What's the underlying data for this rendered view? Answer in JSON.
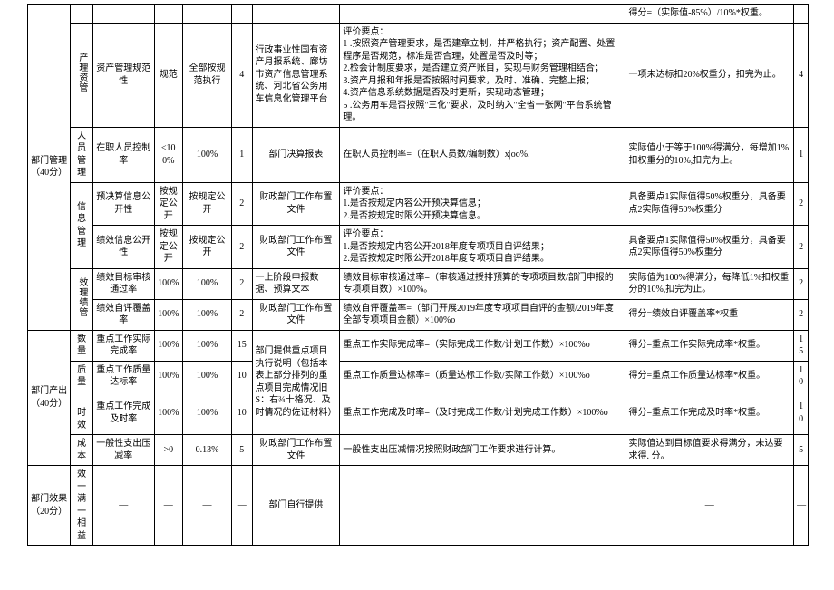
{
  "toprow": {
    "c8": "得分=（实际值-85%）/10%*权重。"
  },
  "sec1": {
    "label": "部门管理（40分）",
    "row1": {
      "g": "产理资管",
      "name": "资产管理规范性",
      "std": "规范",
      "val": "全部按规范执行",
      "w": "4",
      "basis": "行政事业性国有资产月报系统、廊坊市资产信息管理系统、河北省公务用车信息化管理平台",
      "desc": "评价要点：\n1 .按照资产管理要求，是否建章立制，并严格执行；资产配置、处置程序是否规范，标准是否合理，处置是否及时等；\n2.检会计制度要求，是否建立资产账目，实现与财务管理相结合；\n3.资产月报和年报是否按照时间要求，及时、准确、完整上报；\n4.资产信息系统数据是否及时更新，实现动态管理；\n5 .公务用车是否按照\"三化\"要求，及时纳入\"全省一张网\"平台系统管理。",
      "rule": "一项未达标扣20%权重分，扣完为止。",
      "score": "4"
    },
    "row2": {
      "g": "人员管理",
      "name": "在职人员控制率",
      "std": "≤100%",
      "val": "100%",
      "w": "1",
      "basis": "部门决算报表",
      "desc": "在职人员控制率=（在职人员数/编制数）x|oo%.",
      "rule": "实际值小于等于100%得满分，每增加1%扣权重分的10%,扣完为止。",
      "score": "1"
    },
    "row3": {
      "g": "信息管理",
      "name": "预决算信息公开性",
      "std": "按规定公开",
      "val": "按规定公开",
      "w": "2",
      "basis": "财政部门工作布置文件",
      "desc": "评价要点：\n1.是否按规定内容公开预决算信息；\n2.是否按规定时限公开预决算信息。",
      "rule": "具备要点1实际值得50%权重分，具备要点2实际值得50%权重分",
      "score": "2"
    },
    "row4": {
      "name": "绩效信息公开性",
      "std": "按规定公开",
      "val": "按规定公开",
      "w": "2",
      "basis": "财政部门工作布置文件",
      "desc": "评价要点：\n1.是否按规定内容公开2018年度专项项目自评结果；\n2.是否按规定时限公开2018年度专项项目自评结果。",
      "rule": "具备要点1实际值得50%权重分，具备要点2实际值得50%权重分",
      "score": "2"
    },
    "row5": {
      "g": "效理绩管",
      "name": "绩效目标审核通过率",
      "std": "100%",
      "val": "100%",
      "w": "2",
      "basis": "一上阶段申报数据、预算文本",
      "desc": "绩效目标审核通过率=（审核通过授排预算的专项项目数/部门申报的专项项目数）×100%。",
      "rule": "实际值为100%得满分，每降低1%扣权重分的10%,扣完为止。",
      "score": "2"
    },
    "row6": {
      "name": "绩效自评覆盖率",
      "std": "100%",
      "val": "100%",
      "w": "2",
      "basis": "财政部门工作布置文件",
      "desc": "绩效自评覆盖率=（部门开展2019年度专项项目自评的金额/2019年度全部专项项目金额）×100%o",
      "rule": "得分=绩效自评覆盖率*权重",
      "score": "2"
    }
  },
  "sec2": {
    "label": "部门产出（40分）",
    "row7": {
      "g": "数量",
      "name": "重点工作实际完成率",
      "std": "100%",
      "val": "100%",
      "w": "15",
      "basis": "部门提供重点项目执行说明（包括本表上部分排列的重点项目完成情况旧S：右¾十格况、及时情况的佐证材料）",
      "desc": "重点工作实际完成率=（实际完成工作数/计划工作数）×100%o",
      "rule": "得分=重点工作实际完成率*权重。",
      "score": "15"
    },
    "row8": {
      "g": "质量",
      "name": "重点工作质量达标率",
      "std": "100%",
      "val": "100%",
      "w": "10",
      "desc": "重点工作质量达标率=（质量达标工作数/实际工作数）×100%o",
      "rule": "得分=重点工作质量达标率*权重。",
      "score": "10"
    },
    "row9": {
      "g": "—时效",
      "name": "重点工作完成及时率",
      "std": "100%",
      "val": "100%",
      "w": "10",
      "desc": "重点工作完成及时率=（及时完成工作数/计划完成工作数）×100%o",
      "rule": "得分=重点工作完成及时率*权重。",
      "score": "10"
    },
    "row10": {
      "g": "成本",
      "name": "一般性支出压减率",
      "std": ">0",
      "val": "0.13%",
      "w": "5",
      "basis": "财政部门工作布置文件",
      "desc": "一般性支出压减情况按照财政部门工作要求进行计算。",
      "rule": "实际值达到目标值要求得满分，未达要求得. 分。",
      "score": "5"
    }
  },
  "sec3": {
    "label": "部门效果（20分）",
    "row11": {
      "g": "效一满一相益",
      "name": "—",
      "std": "—",
      "val": "—",
      "w": "—",
      "basis": "部门自行提供",
      "desc": "",
      "rule": "—",
      "score": "—"
    }
  }
}
